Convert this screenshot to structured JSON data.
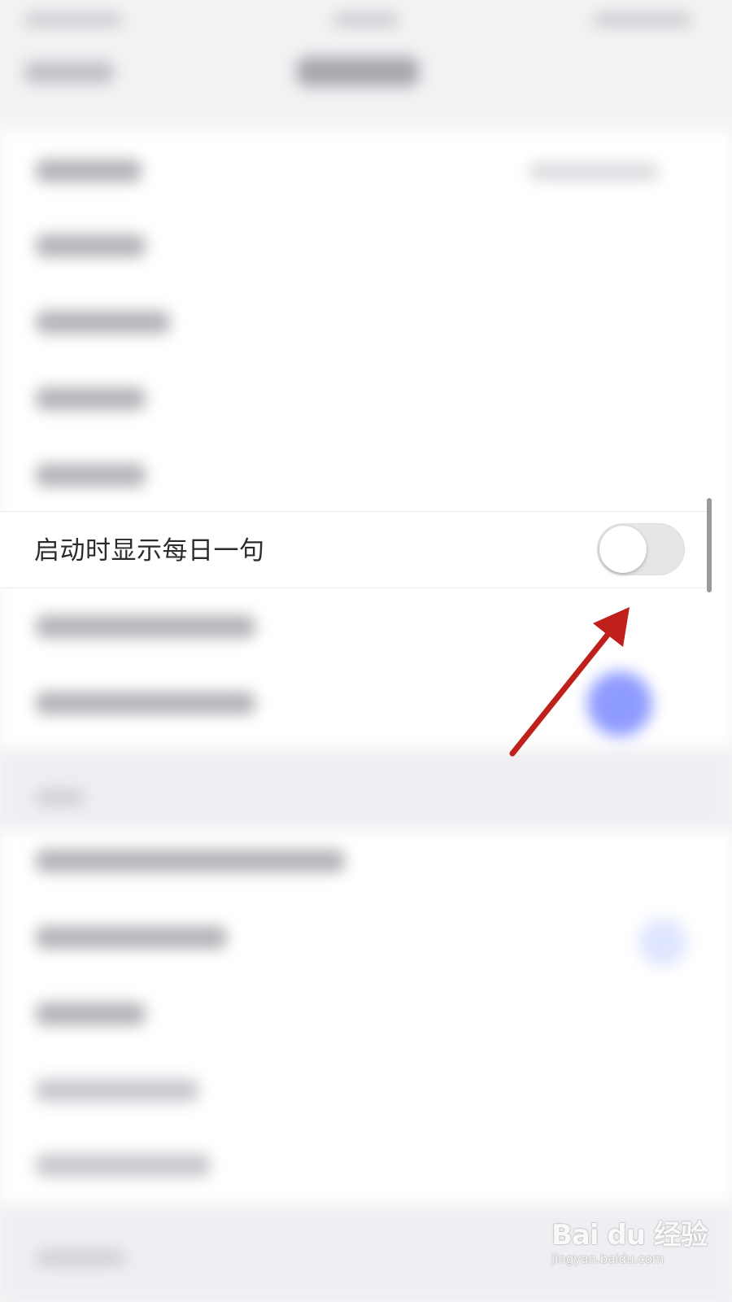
{
  "settings": {
    "focused_row": {
      "label": "启动时显示每日一句",
      "toggle": {
        "state": "off",
        "on": false
      }
    }
  },
  "annotation": {
    "arrow_color": "#c0201b",
    "arrow_target": "toggle-switch"
  },
  "watermark": {
    "logo_text": "Bai du 经验",
    "url_text": "jingyan.baidu.com"
  },
  "colors": {
    "accent_blue": "#8f9cff",
    "toggle_off_track": "#e6e6e9",
    "label_text": "#2b2b2e"
  }
}
